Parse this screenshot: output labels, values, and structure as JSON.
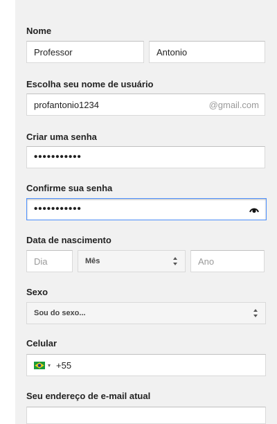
{
  "form": {
    "name": {
      "label": "Nome",
      "first_value": "Professor",
      "last_value": "Antonio"
    },
    "username": {
      "label": "Escolha seu nome de usuário",
      "value": "profantonio1234",
      "suffix": "@gmail.com"
    },
    "password": {
      "label": "Criar uma senha",
      "mask": "•••••••••••"
    },
    "confirm_password": {
      "label": "Confirme sua senha",
      "mask": "•••••••••••",
      "icon": "eye-icon"
    },
    "birthdate": {
      "label": "Data de nascimento",
      "day_placeholder": "Dia",
      "month_value": "Mês",
      "year_placeholder": "Ano"
    },
    "gender": {
      "label": "Sexo",
      "value": "Sou do sexo..."
    },
    "phone": {
      "label": "Celular",
      "flag_icon": "brazil-flag-icon",
      "value": "+55"
    },
    "current_email": {
      "label": "Seu endereço de e-mail atual",
      "value": ""
    }
  },
  "colors": {
    "panel_bg": "#f1f1f1",
    "focus_border": "#4d90fe",
    "placeholder": "#999999"
  }
}
